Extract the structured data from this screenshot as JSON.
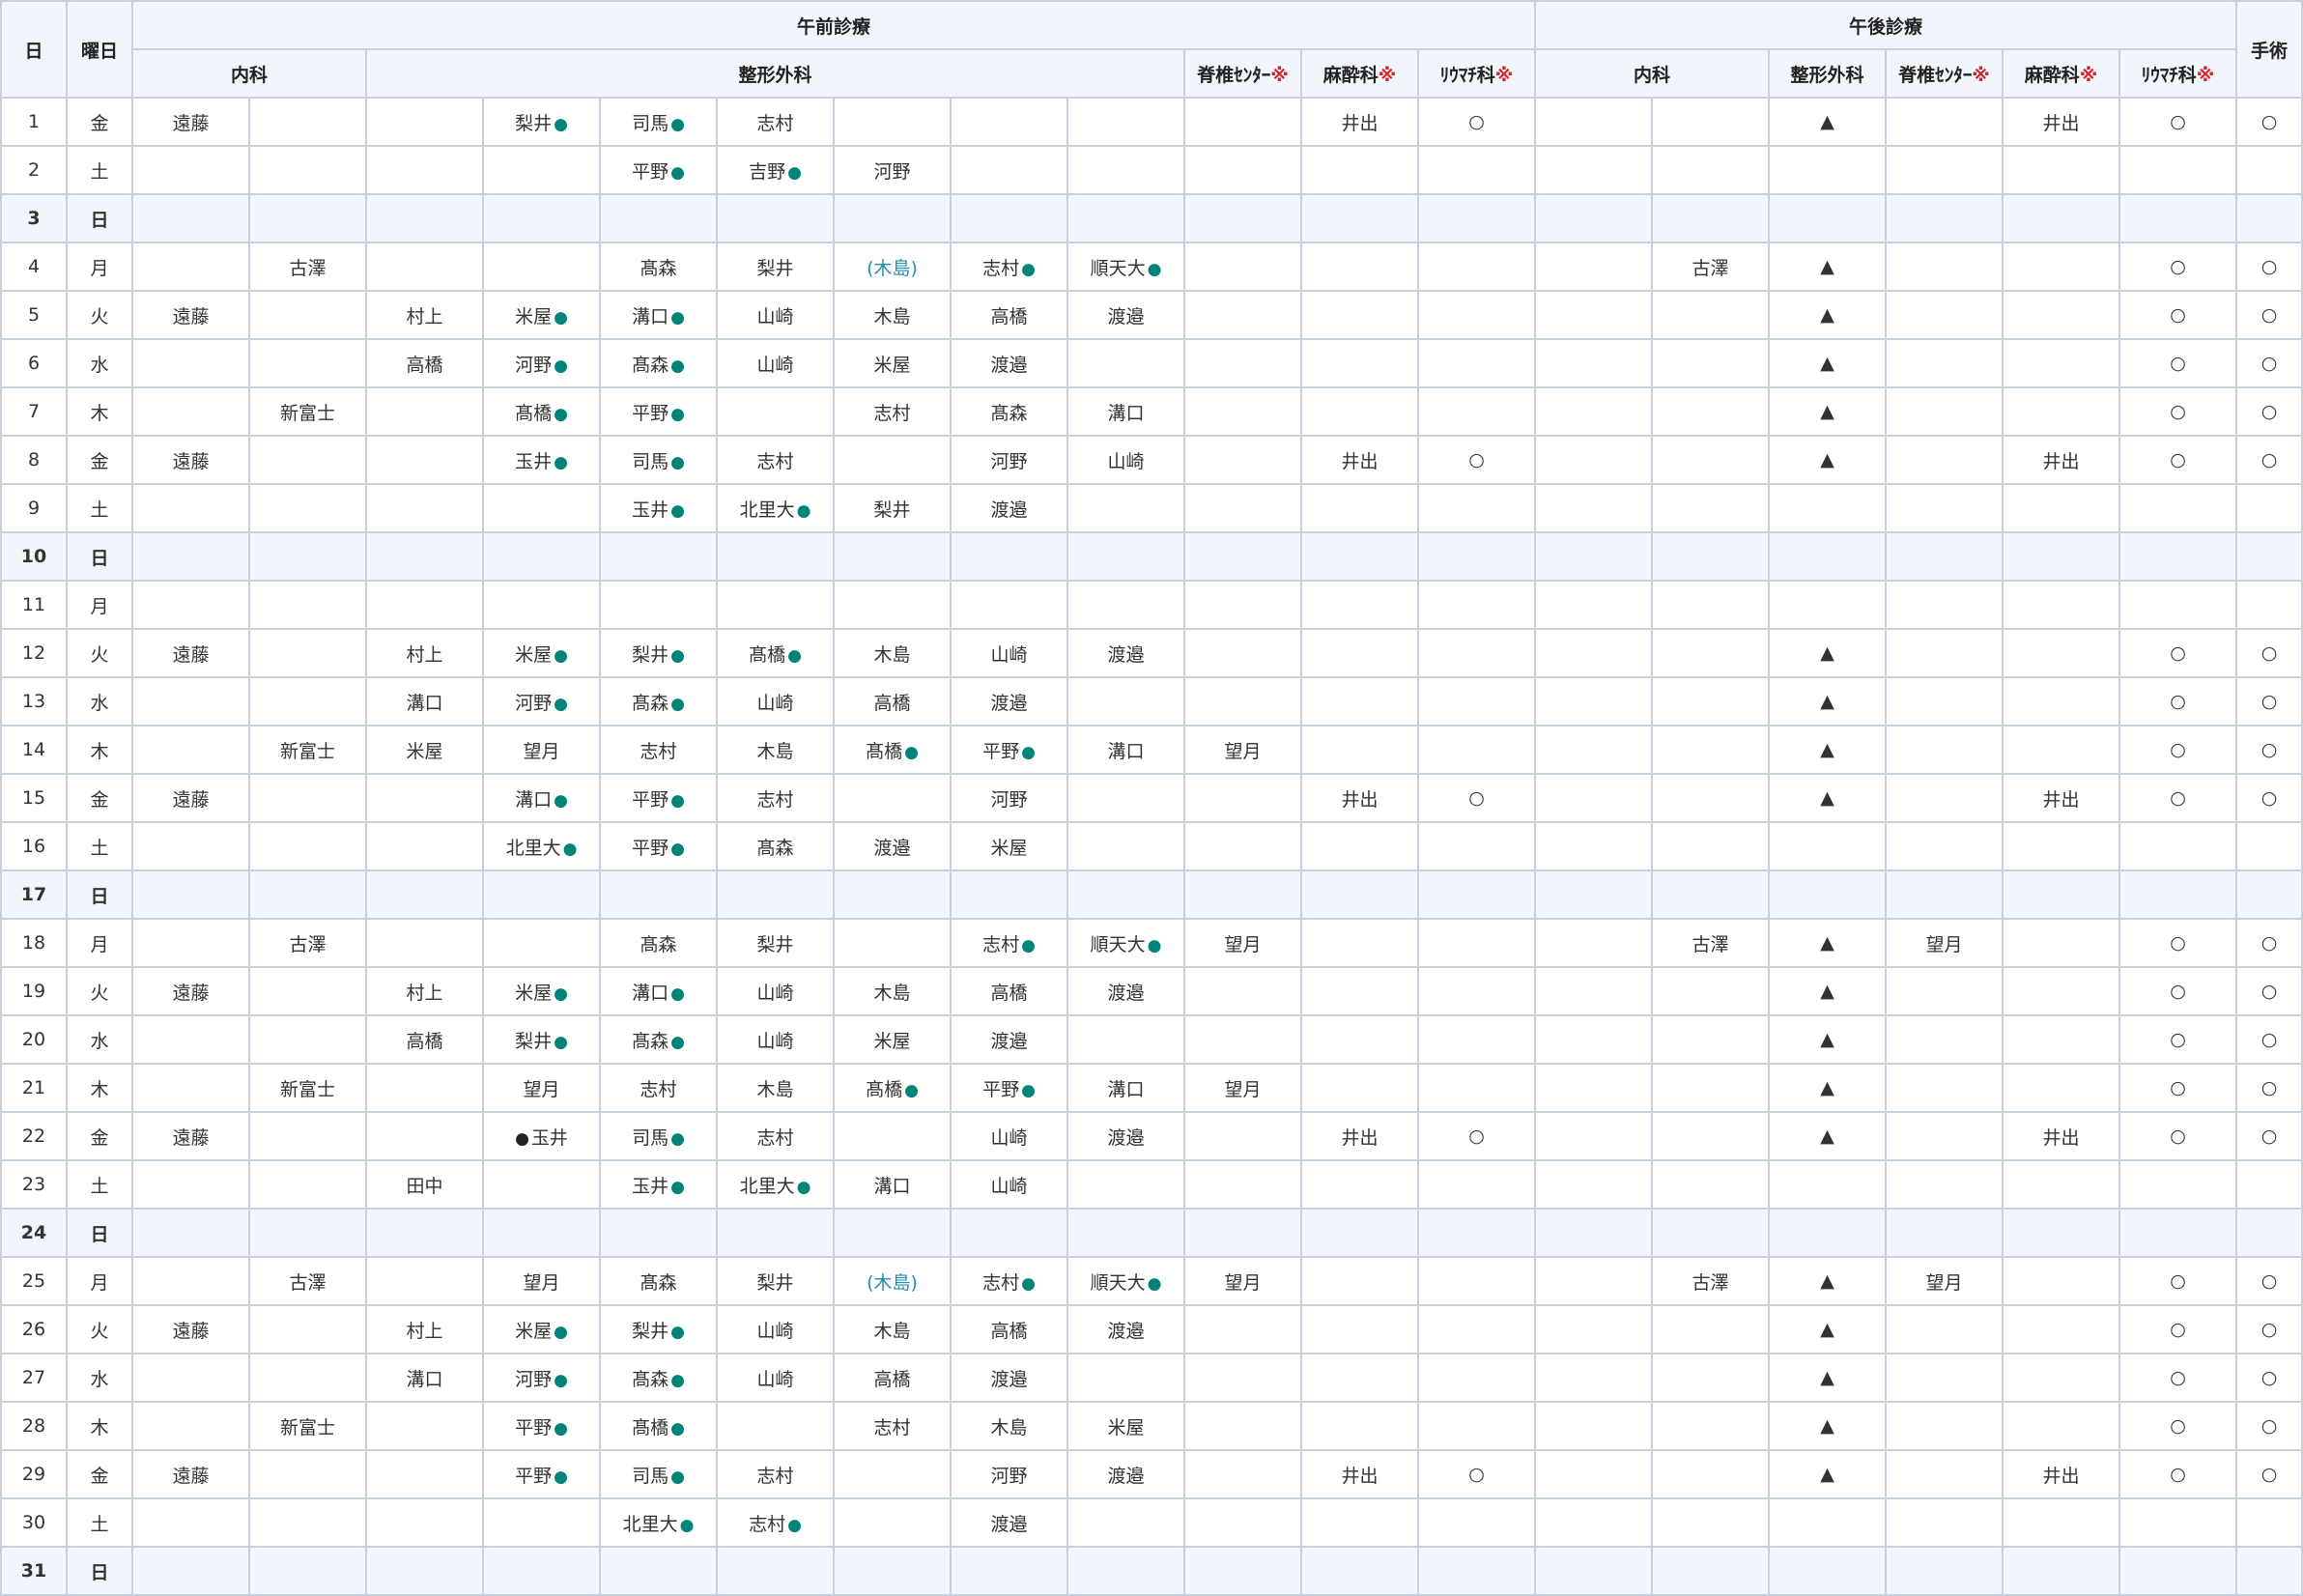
{
  "header": {
    "day": "日",
    "weekday": "曜日",
    "am_title": "午前診療",
    "pm_title": "午後診療",
    "surgery": "手術",
    "am_naika": "内科",
    "am_seikei": "整形外科",
    "am_sekitsui": "脊椎ｾﾝﾀｰ",
    "am_masui": "麻酔科",
    "am_riumachi": "ﾘｳﾏﾁ科",
    "pm_naika": "内科",
    "pm_seikei": "整形外科",
    "pm_sekitsui": "脊椎ｾﾝﾀｰ",
    "pm_masui": "麻酔科",
    "pm_riumachi": "ﾘｳﾏﾁ科",
    "mark": "※"
  },
  "rows": [
    {
      "d": "1",
      "w": "金",
      "c": [
        "遠藤",
        "",
        "",
        "梨井●",
        "司馬●",
        "志村",
        "",
        "",
        "",
        "",
        "井出",
        "○",
        "",
        "",
        "▲",
        "",
        "井出",
        "○",
        "○"
      ]
    },
    {
      "d": "2",
      "w": "土",
      "c": [
        "",
        "",
        "",
        "",
        "平野●",
        "吉野●",
        "河野",
        "",
        "",
        "",
        "",
        "",
        "",
        "",
        "",
        "",
        "",
        "",
        ""
      ]
    },
    {
      "d": "3",
      "w": "日",
      "c": [
        "",
        "",
        "",
        "",
        "",
        "",
        "",
        "",
        "",
        "",
        "",
        "",
        "",
        "",
        "",
        "",
        "",
        "",
        ""
      ]
    },
    {
      "d": "4",
      "w": "月",
      "c": [
        "",
        "古澤",
        "",
        "",
        "髙森",
        "梨井",
        "(木島)",
        "志村●",
        "順天大●",
        "",
        "",
        "",
        "",
        "古澤",
        "▲",
        "",
        "",
        "○",
        "○"
      ]
    },
    {
      "d": "5",
      "w": "火",
      "c": [
        "遠藤",
        "",
        "村上",
        "米屋●",
        "溝口●",
        "山崎",
        "木島",
        "高橋",
        "渡邉",
        "",
        "",
        "",
        "",
        "",
        "▲",
        "",
        "",
        "○",
        "○"
      ]
    },
    {
      "d": "6",
      "w": "水",
      "c": [
        "",
        "",
        "高橋",
        "河野●",
        "髙森●",
        "山崎",
        "米屋",
        "渡邉",
        "",
        "",
        "",
        "",
        "",
        "",
        "▲",
        "",
        "",
        "○",
        "○"
      ]
    },
    {
      "d": "7",
      "w": "木",
      "c": [
        "",
        "新富士",
        "",
        "髙橋●",
        "平野●",
        "",
        "志村",
        "髙森",
        "溝口",
        "",
        "",
        "",
        "",
        "",
        "▲",
        "",
        "",
        "○",
        "○"
      ]
    },
    {
      "d": "8",
      "w": "金",
      "c": [
        "遠藤",
        "",
        "",
        "玉井●",
        "司馬●",
        "志村",
        "",
        "河野",
        "山崎",
        "",
        "井出",
        "○",
        "",
        "",
        "▲",
        "",
        "井出",
        "○",
        "○"
      ]
    },
    {
      "d": "9",
      "w": "土",
      "c": [
        "",
        "",
        "",
        "",
        "玉井●",
        "北里大●",
        "梨井",
        "渡邉",
        "",
        "",
        "",
        "",
        "",
        "",
        "",
        "",
        "",
        "",
        ""
      ]
    },
    {
      "d": "10",
      "w": "日",
      "c": [
        "",
        "",
        "",
        "",
        "",
        "",
        "",
        "",
        "",
        "",
        "",
        "",
        "",
        "",
        "",
        "",
        "",
        "",
        ""
      ]
    },
    {
      "d": "11",
      "w": "月",
      "c": [
        "",
        "",
        "",
        "",
        "",
        "",
        "",
        "",
        "",
        "",
        "",
        "",
        "",
        "",
        "",
        "",
        "",
        "",
        ""
      ]
    },
    {
      "d": "12",
      "w": "火",
      "c": [
        "遠藤",
        "",
        "村上",
        "米屋●",
        "梨井●",
        "髙橋●",
        "木島",
        "山崎",
        "渡邉",
        "",
        "",
        "",
        "",
        "",
        "▲",
        "",
        "",
        "○",
        "○"
      ]
    },
    {
      "d": "13",
      "w": "水",
      "c": [
        "",
        "",
        "溝口",
        "河野●",
        "髙森●",
        "山崎",
        "高橋",
        "渡邉",
        "",
        "",
        "",
        "",
        "",
        "",
        "▲",
        "",
        "",
        "○",
        "○"
      ]
    },
    {
      "d": "14",
      "w": "木",
      "c": [
        "",
        "新富士",
        "米屋",
        "望月",
        "志村",
        "木島",
        "髙橋●",
        "平野●",
        "溝口",
        "望月",
        "",
        "",
        "",
        "",
        "▲",
        "",
        "",
        "○",
        "○"
      ]
    },
    {
      "d": "15",
      "w": "金",
      "c": [
        "遠藤",
        "",
        "",
        "溝口●",
        "平野●",
        "志村",
        "",
        "河野",
        "",
        "",
        "井出",
        "○",
        "",
        "",
        "▲",
        "",
        "井出",
        "○",
        "○"
      ]
    },
    {
      "d": "16",
      "w": "土",
      "c": [
        "",
        "",
        "",
        "北里大●",
        "平野●",
        "髙森",
        "渡邉",
        "米屋",
        "",
        "",
        "",
        "",
        "",
        "",
        "",
        "",
        "",
        "",
        ""
      ]
    },
    {
      "d": "17",
      "w": "日",
      "c": [
        "",
        "",
        "",
        "",
        "",
        "",
        "",
        "",
        "",
        "",
        "",
        "",
        "",
        "",
        "",
        "",
        "",
        "",
        ""
      ]
    },
    {
      "d": "18",
      "w": "月",
      "c": [
        "",
        "古澤",
        "",
        "",
        "髙森",
        "梨井",
        "",
        "志村●",
        "順天大●",
        "望月",
        "",
        "",
        "",
        "古澤",
        "▲",
        "望月",
        "",
        "○",
        "○"
      ]
    },
    {
      "d": "19",
      "w": "火",
      "c": [
        "遠藤",
        "",
        "村上",
        "米屋●",
        "溝口●",
        "山崎",
        "木島",
        "高橋",
        "渡邉",
        "",
        "",
        "",
        "",
        "",
        "▲",
        "",
        "",
        "○",
        "○"
      ]
    },
    {
      "d": "20",
      "w": "水",
      "c": [
        "",
        "",
        "高橋",
        "梨井●",
        "髙森●",
        "山崎",
        "米屋",
        "渡邉",
        "",
        "",
        "",
        "",
        "",
        "",
        "▲",
        "",
        "",
        "○",
        "○"
      ]
    },
    {
      "d": "21",
      "w": "木",
      "c": [
        "",
        "新富士",
        "",
        "望月",
        "志村",
        "木島",
        "髙橋●",
        "平野●",
        "溝口",
        "望月",
        "",
        "",
        "",
        "",
        "▲",
        "",
        "",
        "○",
        "○"
      ]
    },
    {
      "d": "22",
      "w": "金",
      "c": [
        "遠藤",
        "",
        "",
        "●玉井",
        "司馬●",
        "志村",
        "",
        "山崎",
        "渡邉",
        "",
        "井出",
        "○",
        "",
        "",
        "▲",
        "",
        "井出",
        "○",
        "○"
      ]
    },
    {
      "d": "23",
      "w": "土",
      "c": [
        "",
        "",
        "田中",
        "",
        "玉井●",
        "北里大●",
        "溝口",
        "山崎",
        "",
        "",
        "",
        "",
        "",
        "",
        "",
        "",
        "",
        "",
        ""
      ]
    },
    {
      "d": "24",
      "w": "日",
      "c": [
        "",
        "",
        "",
        "",
        "",
        "",
        "",
        "",
        "",
        "",
        "",
        "",
        "",
        "",
        "",
        "",
        "",
        "",
        ""
      ]
    },
    {
      "d": "25",
      "w": "月",
      "c": [
        "",
        "古澤",
        "",
        "望月",
        "髙森",
        "梨井",
        "(木島)",
        "志村●",
        "順天大●",
        "望月",
        "",
        "",
        "",
        "古澤",
        "▲",
        "望月",
        "",
        "○",
        "○"
      ]
    },
    {
      "d": "26",
      "w": "火",
      "c": [
        "遠藤",
        "",
        "村上",
        "米屋●",
        "梨井●",
        "山崎",
        "木島",
        "高橋",
        "渡邉",
        "",
        "",
        "",
        "",
        "",
        "▲",
        "",
        "",
        "○",
        "○"
      ]
    },
    {
      "d": "27",
      "w": "水",
      "c": [
        "",
        "",
        "溝口",
        "河野●",
        "髙森●",
        "山崎",
        "高橋",
        "渡邉",
        "",
        "",
        "",
        "",
        "",
        "",
        "▲",
        "",
        "",
        "○",
        "○"
      ]
    },
    {
      "d": "28",
      "w": "木",
      "c": [
        "",
        "新富士",
        "",
        "平野●",
        "髙橋●",
        "",
        "志村",
        "木島",
        "米屋",
        "",
        "",
        "",
        "",
        "",
        "▲",
        "",
        "",
        "○",
        "○"
      ]
    },
    {
      "d": "29",
      "w": "金",
      "c": [
        "遠藤",
        "",
        "",
        "平野●",
        "司馬●",
        "志村",
        "",
        "河野",
        "渡邉",
        "",
        "井出",
        "○",
        "",
        "",
        "▲",
        "",
        "井出",
        "○",
        "○"
      ]
    },
    {
      "d": "30",
      "w": "土",
      "c": [
        "",
        "",
        "",
        "",
        "北里大●",
        "志村●",
        "",
        "渡邉",
        "",
        "",
        "",
        "",
        "",
        "",
        "",
        "",
        "",
        "",
        ""
      ]
    },
    {
      "d": "31",
      "w": "日",
      "c": [
        "",
        "",
        "",
        "",
        "",
        "",
        "",
        "",
        "",
        "",
        "",
        "",
        "",
        "",
        "",
        "",
        "",
        "",
        ""
      ]
    }
  ]
}
